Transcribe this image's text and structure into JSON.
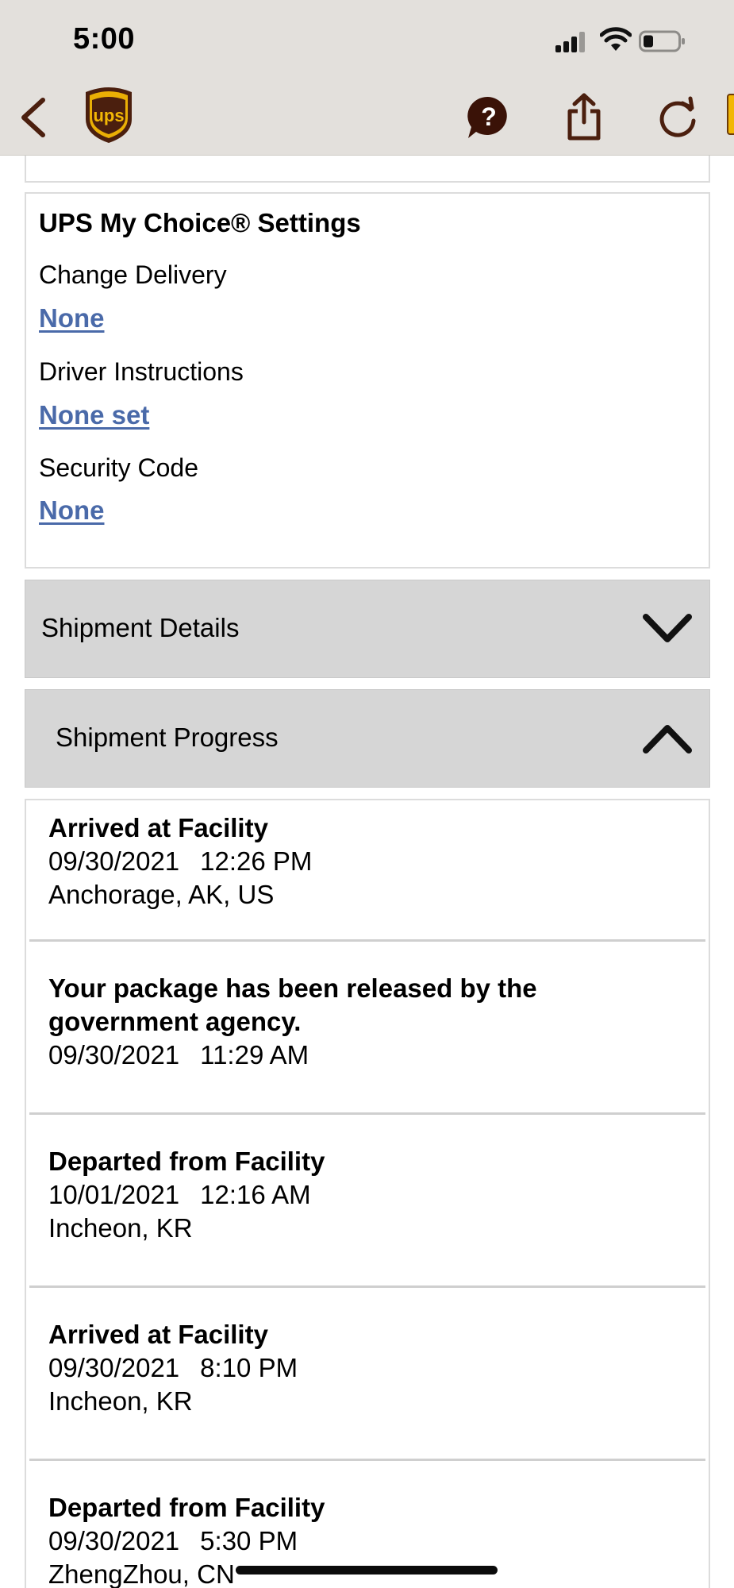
{
  "status_bar": {
    "time": "5:00"
  },
  "toolbar": {
    "back_icon": "chevron-left-icon",
    "logo": "ups-shield-logo",
    "logo_text": "ups",
    "help_icon": "question-bubble-icon",
    "share_icon": "share-icon",
    "reload_icon": "reload-icon"
  },
  "previous_card": {
    "text": ""
  },
  "my_choice": {
    "title": "UPS My Choice® Settings",
    "change_delivery_label": "Change Delivery",
    "change_delivery_value": "None",
    "driver_instructions_label": "Driver Instructions",
    "driver_instructions_value": "None set",
    "security_code_label": "Security Code",
    "security_code_value": "None"
  },
  "sections": {
    "shipment_details": "Shipment Details",
    "shipment_progress": "Shipment Progress"
  },
  "progress_events": [
    {
      "title": "Arrived at Facility",
      "date": "09/30/2021",
      "time": "12:26 PM",
      "location": "Anchorage, AK, US"
    },
    {
      "title": "Your package has been released by the government agency.",
      "date": "09/30/2021",
      "time": "11:29 AM",
      "location": ""
    },
    {
      "title": "Departed from Facility",
      "date": "10/01/2021",
      "time": "12:16 AM",
      "location": "Incheon, KR"
    },
    {
      "title": "Arrived at Facility",
      "date": "09/30/2021",
      "time": "8:10 PM",
      "location": "Incheon, KR"
    },
    {
      "title": "Departed from Facility",
      "date": "09/30/2021",
      "time": "5:30 PM",
      "location": "ZhengZhou, CN"
    }
  ],
  "colors": {
    "toolbar_bg": "#e3e0dc",
    "ups_brown": "#4b1f0e",
    "ups_gold": "#f2b705",
    "link_blue": "#4a6aa9",
    "accordion_bg": "#d6d6d6"
  }
}
